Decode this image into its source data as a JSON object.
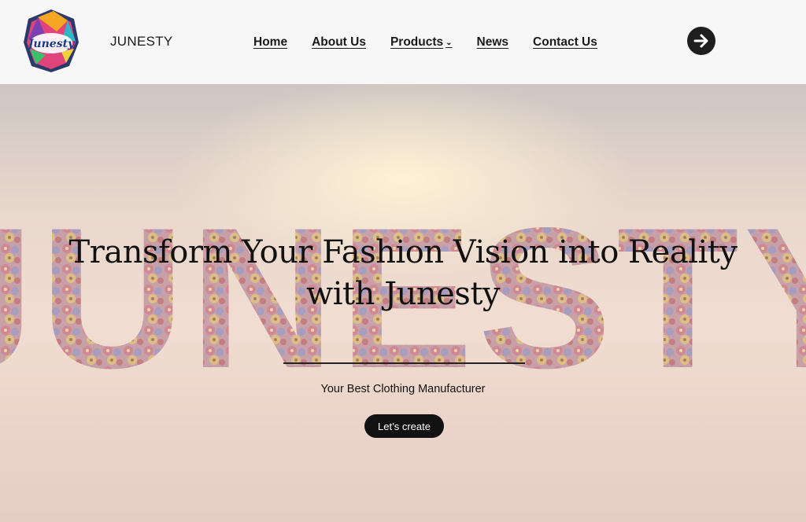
{
  "brand": {
    "name": "JUNESTY",
    "logo_text": "Junesty"
  },
  "nav": {
    "items": [
      {
        "label": "Home"
      },
      {
        "label": "About Us"
      },
      {
        "label": "Products",
        "has_dropdown": true
      },
      {
        "label": "News"
      },
      {
        "label": "Contact Us"
      }
    ],
    "arrow_icon": "arrow-right-icon"
  },
  "hero": {
    "background_word": "JUNESTY",
    "title": "Transform Your Fashion Vision into Reality with Junesty",
    "subtitle": "Your Best Clothing Manufacturer",
    "cta_label": "Let’s create"
  },
  "colors": {
    "header_bg": "#f7f7f7",
    "text_dark": "#111111",
    "button_bg": "#121212",
    "button_text": "#ffffff"
  }
}
